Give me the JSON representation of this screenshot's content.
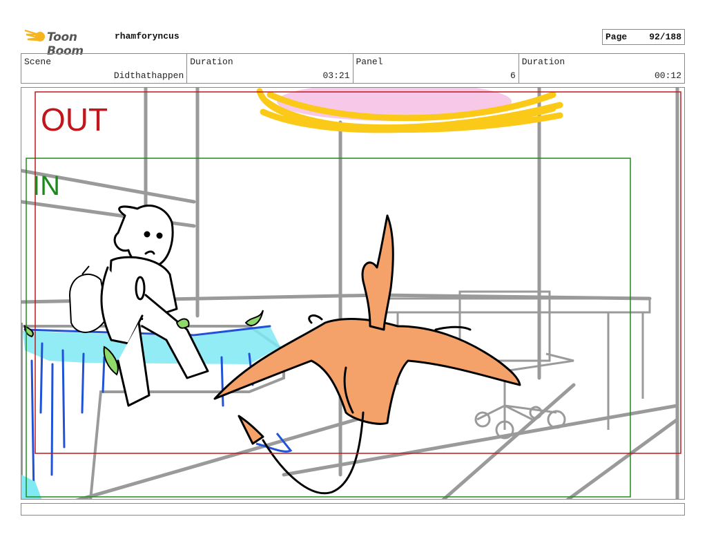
{
  "header": {
    "logo_text": "Toon Boom",
    "project": "rhamforyncus",
    "page_label": "Page",
    "page_value": "92/188"
  },
  "info": {
    "scene_label": "Scene",
    "scene_value": "Didthathappen",
    "duration1_label": "Duration",
    "duration1_value": "03:21",
    "panel_label": "Panel",
    "panel_value": "6",
    "duration2_label": "Duration",
    "duration2_value": "00:12"
  },
  "frames": {
    "out_label": "OUT",
    "in_label": "IN",
    "out_color": "#c0161c",
    "in_color": "#1e8a1e"
  },
  "colors": {
    "creature": "#f4a26a",
    "sun": "#fbc917",
    "water": "#7fe9f4",
    "lines": "#9a9a9a"
  }
}
